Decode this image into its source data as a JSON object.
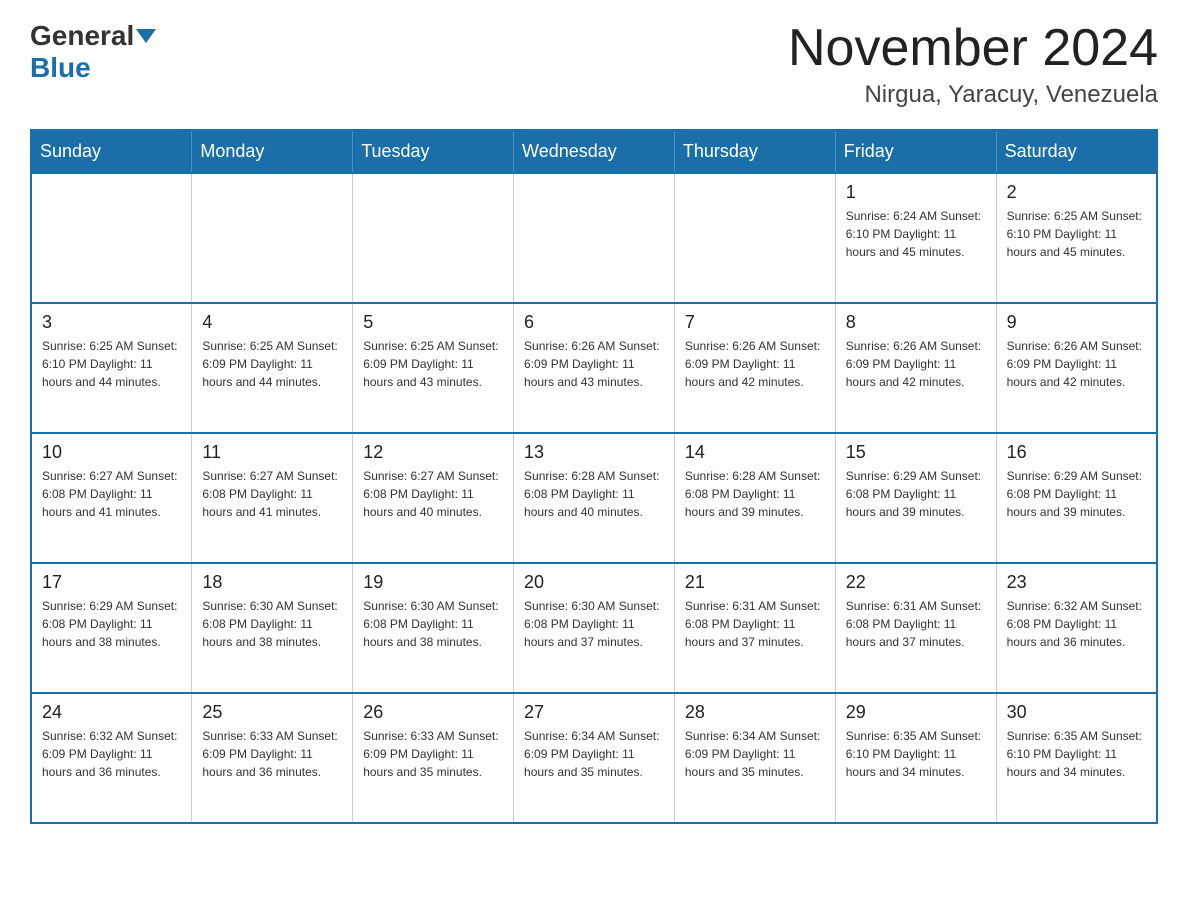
{
  "header": {
    "logo_general": "General",
    "logo_blue": "Blue",
    "month_title": "November 2024",
    "location": "Nirgua, Yaracuy, Venezuela"
  },
  "days_of_week": [
    "Sunday",
    "Monday",
    "Tuesday",
    "Wednesday",
    "Thursday",
    "Friday",
    "Saturday"
  ],
  "weeks": [
    [
      {
        "day": "",
        "info": ""
      },
      {
        "day": "",
        "info": ""
      },
      {
        "day": "",
        "info": ""
      },
      {
        "day": "",
        "info": ""
      },
      {
        "day": "",
        "info": ""
      },
      {
        "day": "1",
        "info": "Sunrise: 6:24 AM\nSunset: 6:10 PM\nDaylight: 11 hours and 45 minutes."
      },
      {
        "day": "2",
        "info": "Sunrise: 6:25 AM\nSunset: 6:10 PM\nDaylight: 11 hours and 45 minutes."
      }
    ],
    [
      {
        "day": "3",
        "info": "Sunrise: 6:25 AM\nSunset: 6:10 PM\nDaylight: 11 hours and 44 minutes."
      },
      {
        "day": "4",
        "info": "Sunrise: 6:25 AM\nSunset: 6:09 PM\nDaylight: 11 hours and 44 minutes."
      },
      {
        "day": "5",
        "info": "Sunrise: 6:25 AM\nSunset: 6:09 PM\nDaylight: 11 hours and 43 minutes."
      },
      {
        "day": "6",
        "info": "Sunrise: 6:26 AM\nSunset: 6:09 PM\nDaylight: 11 hours and 43 minutes."
      },
      {
        "day": "7",
        "info": "Sunrise: 6:26 AM\nSunset: 6:09 PM\nDaylight: 11 hours and 42 minutes."
      },
      {
        "day": "8",
        "info": "Sunrise: 6:26 AM\nSunset: 6:09 PM\nDaylight: 11 hours and 42 minutes."
      },
      {
        "day": "9",
        "info": "Sunrise: 6:26 AM\nSunset: 6:09 PM\nDaylight: 11 hours and 42 minutes."
      }
    ],
    [
      {
        "day": "10",
        "info": "Sunrise: 6:27 AM\nSunset: 6:08 PM\nDaylight: 11 hours and 41 minutes."
      },
      {
        "day": "11",
        "info": "Sunrise: 6:27 AM\nSunset: 6:08 PM\nDaylight: 11 hours and 41 minutes."
      },
      {
        "day": "12",
        "info": "Sunrise: 6:27 AM\nSunset: 6:08 PM\nDaylight: 11 hours and 40 minutes."
      },
      {
        "day": "13",
        "info": "Sunrise: 6:28 AM\nSunset: 6:08 PM\nDaylight: 11 hours and 40 minutes."
      },
      {
        "day": "14",
        "info": "Sunrise: 6:28 AM\nSunset: 6:08 PM\nDaylight: 11 hours and 39 minutes."
      },
      {
        "day": "15",
        "info": "Sunrise: 6:29 AM\nSunset: 6:08 PM\nDaylight: 11 hours and 39 minutes."
      },
      {
        "day": "16",
        "info": "Sunrise: 6:29 AM\nSunset: 6:08 PM\nDaylight: 11 hours and 39 minutes."
      }
    ],
    [
      {
        "day": "17",
        "info": "Sunrise: 6:29 AM\nSunset: 6:08 PM\nDaylight: 11 hours and 38 minutes."
      },
      {
        "day": "18",
        "info": "Sunrise: 6:30 AM\nSunset: 6:08 PM\nDaylight: 11 hours and 38 minutes."
      },
      {
        "day": "19",
        "info": "Sunrise: 6:30 AM\nSunset: 6:08 PM\nDaylight: 11 hours and 38 minutes."
      },
      {
        "day": "20",
        "info": "Sunrise: 6:30 AM\nSunset: 6:08 PM\nDaylight: 11 hours and 37 minutes."
      },
      {
        "day": "21",
        "info": "Sunrise: 6:31 AM\nSunset: 6:08 PM\nDaylight: 11 hours and 37 minutes."
      },
      {
        "day": "22",
        "info": "Sunrise: 6:31 AM\nSunset: 6:08 PM\nDaylight: 11 hours and 37 minutes."
      },
      {
        "day": "23",
        "info": "Sunrise: 6:32 AM\nSunset: 6:08 PM\nDaylight: 11 hours and 36 minutes."
      }
    ],
    [
      {
        "day": "24",
        "info": "Sunrise: 6:32 AM\nSunset: 6:09 PM\nDaylight: 11 hours and 36 minutes."
      },
      {
        "day": "25",
        "info": "Sunrise: 6:33 AM\nSunset: 6:09 PM\nDaylight: 11 hours and 36 minutes."
      },
      {
        "day": "26",
        "info": "Sunrise: 6:33 AM\nSunset: 6:09 PM\nDaylight: 11 hours and 35 minutes."
      },
      {
        "day": "27",
        "info": "Sunrise: 6:34 AM\nSunset: 6:09 PM\nDaylight: 11 hours and 35 minutes."
      },
      {
        "day": "28",
        "info": "Sunrise: 6:34 AM\nSunset: 6:09 PM\nDaylight: 11 hours and 35 minutes."
      },
      {
        "day": "29",
        "info": "Sunrise: 6:35 AM\nSunset: 6:10 PM\nDaylight: 11 hours and 34 minutes."
      },
      {
        "day": "30",
        "info": "Sunrise: 6:35 AM\nSunset: 6:10 PM\nDaylight: 11 hours and 34 minutes."
      }
    ]
  ]
}
